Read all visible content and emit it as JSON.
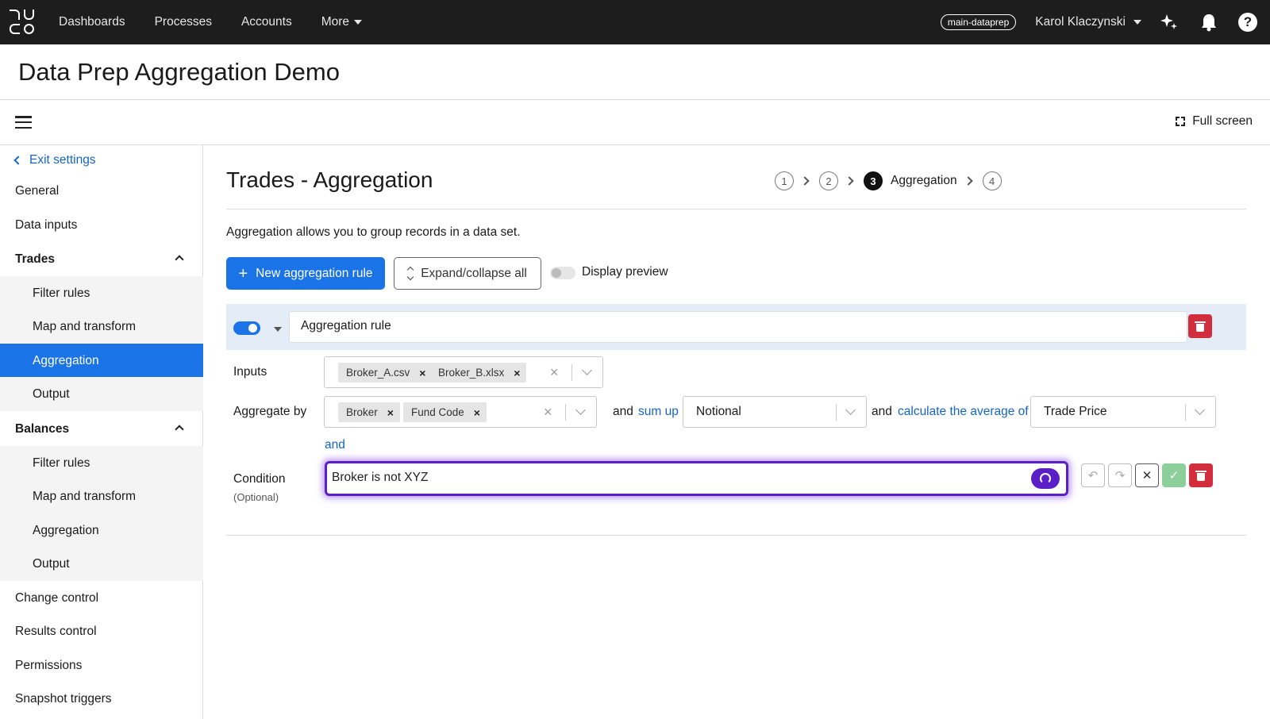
{
  "topbar": {
    "nav": [
      "Dashboards",
      "Processes",
      "Accounts",
      "More"
    ],
    "environment": "main-dataprep",
    "user": "Karol Klaczynski",
    "icons": [
      "sparkle-icon",
      "bell-icon",
      "help-icon"
    ]
  },
  "page": {
    "title": "Data Prep Aggregation Demo",
    "fullscreen_label": "Full screen"
  },
  "sidebar": {
    "exit_label": "Exit settings",
    "items": [
      {
        "label": "General"
      },
      {
        "label": "Data inputs"
      },
      {
        "label": "Trades"
      },
      {
        "label": "Filter rules"
      },
      {
        "label": "Map and transform"
      },
      {
        "label": "Aggregation"
      },
      {
        "label": "Output"
      },
      {
        "label": "Balances"
      },
      {
        "label": "Filter rules"
      },
      {
        "label": "Map and transform"
      },
      {
        "label": "Aggregation"
      },
      {
        "label": "Output"
      },
      {
        "label": "Change control"
      },
      {
        "label": "Results control"
      },
      {
        "label": "Permissions"
      },
      {
        "label": "Snapshot triggers"
      }
    ],
    "active": "Aggregation"
  },
  "main": {
    "title": "Trades - Aggregation",
    "steps": [
      "1",
      "2",
      "3",
      "4"
    ],
    "current_step_label": "Aggregation",
    "description": "Aggregation allows you to group records in a data set.",
    "new_rule_label": "New aggregation rule",
    "expand_label": "Expand/collapse all",
    "preview_label": "Display preview",
    "rule": {
      "name": "Aggregation rule",
      "inputs_label": "Inputs",
      "inputs": [
        "Broker_A.csv",
        "Broker_B.xlsx"
      ],
      "aggregate_label": "Aggregate by",
      "aggregate_by": [
        "Broker",
        "Fund Code"
      ],
      "and1": "and",
      "sum_up": "sum up",
      "sum_field": "Notional",
      "and2": "and",
      "average_label": "calculate the average of",
      "average_field": "Trade Price",
      "and_link": "and",
      "condition_label": "Condition",
      "condition_optional": "(Optional)",
      "condition_value": "Broker is not XYZ"
    }
  }
}
